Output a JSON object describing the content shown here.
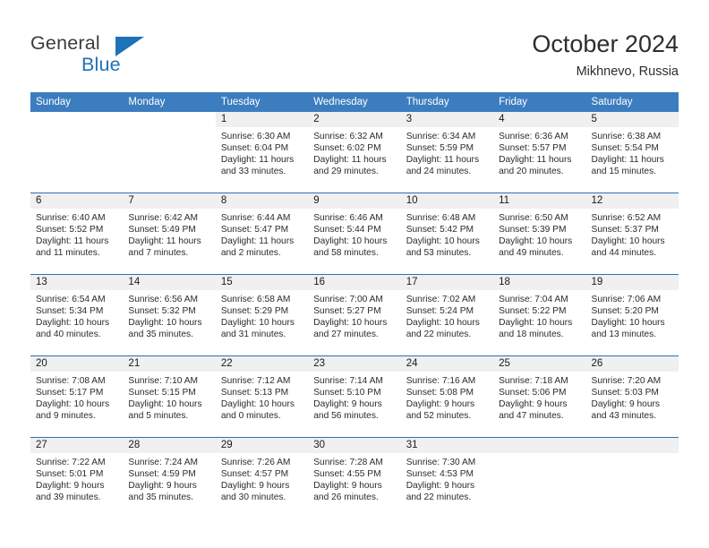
{
  "brand": {
    "word1": "General",
    "word2": "Blue",
    "triangle_color": "#1d72b8",
    "word1_color": "#3b3b3b"
  },
  "header": {
    "title": "October 2024",
    "subtitle": "Mikhnevo, Russia"
  },
  "theme": {
    "header_row_bg": "#3b7dbf",
    "daynum_band_bg": "#f0f0f0",
    "week_divider": "#2f6fb0",
    "text": "#2b2b2b"
  },
  "weekday_headers": [
    "Sunday",
    "Monday",
    "Tuesday",
    "Wednesday",
    "Thursday",
    "Friday",
    "Saturday"
  ],
  "weeks": [
    [
      {
        "day": "",
        "lines": [],
        "blank": true
      },
      {
        "day": "",
        "lines": [],
        "blank": true
      },
      {
        "day": "1",
        "lines": [
          "Sunrise: 6:30 AM",
          "Sunset: 6:04 PM",
          "Daylight: 11 hours",
          "and 33 minutes."
        ]
      },
      {
        "day": "2",
        "lines": [
          "Sunrise: 6:32 AM",
          "Sunset: 6:02 PM",
          "Daylight: 11 hours",
          "and 29 minutes."
        ]
      },
      {
        "day": "3",
        "lines": [
          "Sunrise: 6:34 AM",
          "Sunset: 5:59 PM",
          "Daylight: 11 hours",
          "and 24 minutes."
        ]
      },
      {
        "day": "4",
        "lines": [
          "Sunrise: 6:36 AM",
          "Sunset: 5:57 PM",
          "Daylight: 11 hours",
          "and 20 minutes."
        ]
      },
      {
        "day": "5",
        "lines": [
          "Sunrise: 6:38 AM",
          "Sunset: 5:54 PM",
          "Daylight: 11 hours",
          "and 15 minutes."
        ]
      }
    ],
    [
      {
        "day": "6",
        "lines": [
          "Sunrise: 6:40 AM",
          "Sunset: 5:52 PM",
          "Daylight: 11 hours",
          "and 11 minutes."
        ]
      },
      {
        "day": "7",
        "lines": [
          "Sunrise: 6:42 AM",
          "Sunset: 5:49 PM",
          "Daylight: 11 hours",
          "and 7 minutes."
        ]
      },
      {
        "day": "8",
        "lines": [
          "Sunrise: 6:44 AM",
          "Sunset: 5:47 PM",
          "Daylight: 11 hours",
          "and 2 minutes."
        ]
      },
      {
        "day": "9",
        "lines": [
          "Sunrise: 6:46 AM",
          "Sunset: 5:44 PM",
          "Daylight: 10 hours",
          "and 58 minutes."
        ]
      },
      {
        "day": "10",
        "lines": [
          "Sunrise: 6:48 AM",
          "Sunset: 5:42 PM",
          "Daylight: 10 hours",
          "and 53 minutes."
        ]
      },
      {
        "day": "11",
        "lines": [
          "Sunrise: 6:50 AM",
          "Sunset: 5:39 PM",
          "Daylight: 10 hours",
          "and 49 minutes."
        ]
      },
      {
        "day": "12",
        "lines": [
          "Sunrise: 6:52 AM",
          "Sunset: 5:37 PM",
          "Daylight: 10 hours",
          "and 44 minutes."
        ]
      }
    ],
    [
      {
        "day": "13",
        "lines": [
          "Sunrise: 6:54 AM",
          "Sunset: 5:34 PM",
          "Daylight: 10 hours",
          "and 40 minutes."
        ]
      },
      {
        "day": "14",
        "lines": [
          "Sunrise: 6:56 AM",
          "Sunset: 5:32 PM",
          "Daylight: 10 hours",
          "and 35 minutes."
        ]
      },
      {
        "day": "15",
        "lines": [
          "Sunrise: 6:58 AM",
          "Sunset: 5:29 PM",
          "Daylight: 10 hours",
          "and 31 minutes."
        ]
      },
      {
        "day": "16",
        "lines": [
          "Sunrise: 7:00 AM",
          "Sunset: 5:27 PM",
          "Daylight: 10 hours",
          "and 27 minutes."
        ]
      },
      {
        "day": "17",
        "lines": [
          "Sunrise: 7:02 AM",
          "Sunset: 5:24 PM",
          "Daylight: 10 hours",
          "and 22 minutes."
        ]
      },
      {
        "day": "18",
        "lines": [
          "Sunrise: 7:04 AM",
          "Sunset: 5:22 PM",
          "Daylight: 10 hours",
          "and 18 minutes."
        ]
      },
      {
        "day": "19",
        "lines": [
          "Sunrise: 7:06 AM",
          "Sunset: 5:20 PM",
          "Daylight: 10 hours",
          "and 13 minutes."
        ]
      }
    ],
    [
      {
        "day": "20",
        "lines": [
          "Sunrise: 7:08 AM",
          "Sunset: 5:17 PM",
          "Daylight: 10 hours",
          "and 9 minutes."
        ]
      },
      {
        "day": "21",
        "lines": [
          "Sunrise: 7:10 AM",
          "Sunset: 5:15 PM",
          "Daylight: 10 hours",
          "and 5 minutes."
        ]
      },
      {
        "day": "22",
        "lines": [
          "Sunrise: 7:12 AM",
          "Sunset: 5:13 PM",
          "Daylight: 10 hours",
          "and 0 minutes."
        ]
      },
      {
        "day": "23",
        "lines": [
          "Sunrise: 7:14 AM",
          "Sunset: 5:10 PM",
          "Daylight: 9 hours",
          "and 56 minutes."
        ]
      },
      {
        "day": "24",
        "lines": [
          "Sunrise: 7:16 AM",
          "Sunset: 5:08 PM",
          "Daylight: 9 hours",
          "and 52 minutes."
        ]
      },
      {
        "day": "25",
        "lines": [
          "Sunrise: 7:18 AM",
          "Sunset: 5:06 PM",
          "Daylight: 9 hours",
          "and 47 minutes."
        ]
      },
      {
        "day": "26",
        "lines": [
          "Sunrise: 7:20 AM",
          "Sunset: 5:03 PM",
          "Daylight: 9 hours",
          "and 43 minutes."
        ]
      }
    ],
    [
      {
        "day": "27",
        "lines": [
          "Sunrise: 7:22 AM",
          "Sunset: 5:01 PM",
          "Daylight: 9 hours",
          "and 39 minutes."
        ]
      },
      {
        "day": "28",
        "lines": [
          "Sunrise: 7:24 AM",
          "Sunset: 4:59 PM",
          "Daylight: 9 hours",
          "and 35 minutes."
        ]
      },
      {
        "day": "29",
        "lines": [
          "Sunrise: 7:26 AM",
          "Sunset: 4:57 PM",
          "Daylight: 9 hours",
          "and 30 minutes."
        ]
      },
      {
        "day": "30",
        "lines": [
          "Sunrise: 7:28 AM",
          "Sunset: 4:55 PM",
          "Daylight: 9 hours",
          "and 26 minutes."
        ]
      },
      {
        "day": "31",
        "lines": [
          "Sunrise: 7:30 AM",
          "Sunset: 4:53 PM",
          "Daylight: 9 hours",
          "and 22 minutes."
        ]
      },
      {
        "day": "",
        "lines": [],
        "empty": true
      },
      {
        "day": "",
        "lines": [],
        "empty": true
      }
    ]
  ]
}
